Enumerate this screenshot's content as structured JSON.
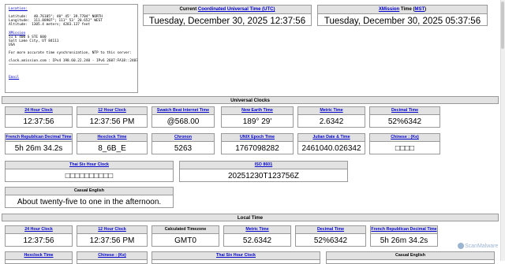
{
  "info": {
    "location_label": "Location:",
    "latitude": "Latitude:   40.76105°; 40° 45' 39.7704\" NORTH",
    "longitude": "Longitude:  111.88907°; 111° 53' 20.652\" WEST",
    "altitude": "Altitude:  1305.4 meters; 4283.137 feet",
    "xmission_link": "XMission",
    "address1": "51 E 400 S STE 600",
    "address2": "Salt Lake City, UT 84111",
    "address3": "USA",
    "ntp_text": "For more accurate time synchronization, NTP to this server:",
    "ntp_server": "clock.xmission.com : IPv4 198.60.22.240 - IPv6 2607:FA18::2407",
    "email_link": "Email"
  },
  "utc": {
    "label_prefix": "Current ",
    "label_link": "Coordinated Universal Time (UTC)",
    "value": "Tuesday, December 30, 2025 12:37:56"
  },
  "mst": {
    "label_link": "XMission",
    "label_mid": " Time (",
    "label_link2": "MST",
    "label_suffix": ")",
    "value": "Tuesday, December 30, 2025 05:37:56"
  },
  "universal": {
    "title": "Universal Clocks",
    "row1": [
      {
        "label": "24 Hour Clock",
        "value": "12:37:56"
      },
      {
        "label": "12 Hour Clock",
        "value": "12:37:56 PM"
      },
      {
        "label": "Swatch Beat Internet Time",
        "value": "@568.00"
      },
      {
        "label": "New Earth Time",
        "value": "189° 29'"
      },
      {
        "label": "Metric Time",
        "value": "2.6342"
      },
      {
        "label": "Decimal Time",
        "value": "52%6342"
      }
    ],
    "row2": [
      {
        "label": "French Republican Decimal Time",
        "value": "5h 26m 34.2s"
      },
      {
        "label": "Hexclock Time",
        "value": "8_6B_E"
      },
      {
        "label": "Chronon",
        "value": "5263"
      },
      {
        "label": "UNIX Epoch Time",
        "value": "1767098282"
      },
      {
        "label": "Julian Date & Time",
        "value": "2461040.026342"
      },
      {
        "label": "Chinese : (Ke)",
        "value": "□□□□"
      }
    ],
    "thai": {
      "label": "Thai Six Hour Clock",
      "value": "□□□□□□□□□□"
    },
    "iso": {
      "label": "ISO 8601",
      "value": "20251230T123756Z"
    },
    "casual": {
      "label": "Casual English",
      "value": "About twenty-five to one in the afternoon."
    }
  },
  "local": {
    "title": "Local Time",
    "row1": [
      {
        "label": "24 Hour Clock",
        "value": "12:37:56"
      },
      {
        "label": "12 Hour Clock",
        "value": "12:37:56 PM"
      },
      {
        "label": "Calculated Timezone",
        "value": "GMT0"
      },
      {
        "label": "Metric Time",
        "value": "52.6342"
      },
      {
        "label": "Decimal Time",
        "value": "52%6342"
      },
      {
        "label": "French Republican Decimal Time",
        "value": "5h 26m 34.2s"
      }
    ],
    "row2": [
      {
        "label": "Hexclock Time"
      },
      {
        "label": "Chinese : (Ke)"
      },
      {
        "label": "Thai Six Hour Clock"
      },
      {
        "label": "Casual English"
      }
    ]
  },
  "watermark": "ScanMalware",
  "colors": {
    "link": "#0000cc",
    "header_bg": "#e2e2e2",
    "border": "#999999"
  }
}
